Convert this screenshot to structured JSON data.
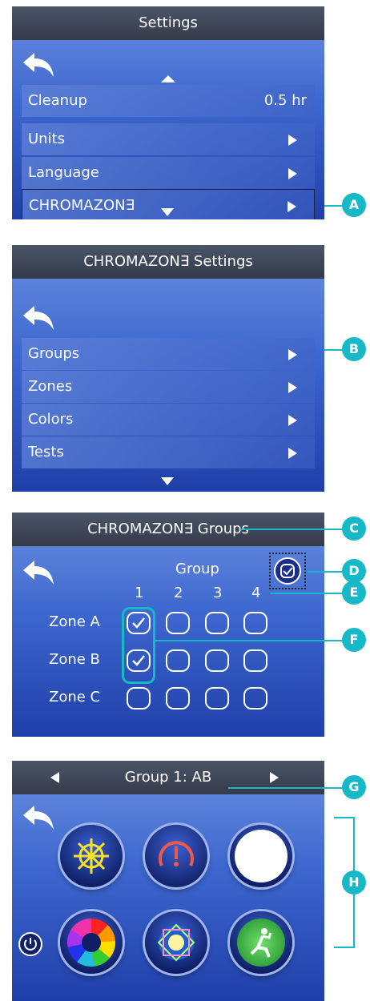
{
  "panel1": {
    "title": "Settings",
    "items": [
      {
        "label": "Cleanup",
        "value": "0.5 hr"
      },
      {
        "label": "Units"
      },
      {
        "label": "Language"
      },
      {
        "label": "CHROMAZON∃"
      }
    ]
  },
  "panel2": {
    "title": "CHROMAZON∃ Settings",
    "items": [
      {
        "label": "Groups"
      },
      {
        "label": "Zones"
      },
      {
        "label": "Colors"
      },
      {
        "label": "Tests"
      }
    ]
  },
  "panel3": {
    "title": "CHROMAZON∃ Groups",
    "group_header": "Group",
    "group_numbers": [
      "1",
      "2",
      "3",
      "4"
    ],
    "zones": [
      {
        "label": "Zone A",
        "checked": [
          true,
          false,
          false,
          false
        ]
      },
      {
        "label": "Zone B",
        "checked": [
          true,
          false,
          false,
          false
        ]
      },
      {
        "label": "Zone C",
        "checked": [
          false,
          false,
          false,
          false
        ]
      }
    ]
  },
  "panel4": {
    "title": "Group 1: AB",
    "buttons": [
      "ship-wheel-icon",
      "gauge-alert-icon",
      "white-light-icon",
      "color-wheel-icon",
      "kaleidoscope-icon",
      "relax-icon"
    ]
  },
  "callouts": [
    "A",
    "B",
    "C",
    "D",
    "E",
    "F",
    "G",
    "H"
  ],
  "colors": {
    "accent": "#17b8c8",
    "panel_top": "#6a8fe0",
    "panel_bottom": "#1f3fa8",
    "titlebar": "#3b4252"
  }
}
